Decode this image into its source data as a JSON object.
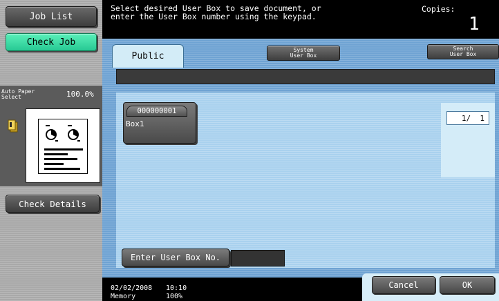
{
  "sidebar": {
    "job_list_label": "Job List",
    "check_job_label": "Check Job",
    "paper_select_label": "Auto Paper Select",
    "paper_select_line1": "Auto Paper",
    "paper_select_line2": "Select",
    "zoom": "100.0%",
    "check_details_label": "Check Details"
  },
  "message": {
    "line1": "Select desired User Box to save document, or",
    "line2": "enter the User Box number using the keypad."
  },
  "copies": {
    "label": "Copies:",
    "value": "1"
  },
  "tabs": {
    "public": "Public",
    "system_line1": "System",
    "system_line2": "User Box",
    "search_line1": "Search",
    "search_line2": "User Box"
  },
  "boxes": [
    {
      "number": "000000001",
      "name": "Box1"
    }
  ],
  "pagination": {
    "indicator": "1/  1"
  },
  "enter_box_label": "Enter User Box No.",
  "status": {
    "date": "02/02/2008",
    "time": "10:10",
    "memory_label": "Memory",
    "memory_value": "100%"
  },
  "actions": {
    "cancel": "Cancel",
    "ok": "OK"
  },
  "colors": {
    "main_bg": "#6fa3d3",
    "content_bg": "#a9d1ee",
    "check_job_accent": "#3ad9a3",
    "sidebar_bg": "#a9a9a9"
  }
}
